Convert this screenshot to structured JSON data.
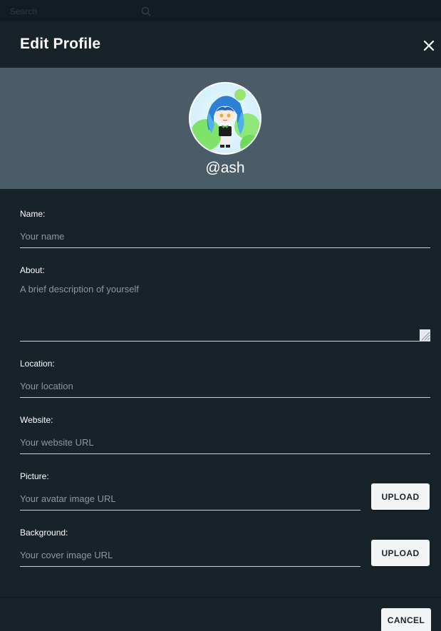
{
  "background": {
    "search_text": "Search",
    "search_icon": "search-icon"
  },
  "dialog": {
    "title": "Edit Profile",
    "close_icon": "close-icon"
  },
  "profile": {
    "username": "@ash",
    "avatar": "anime-character-avatar"
  },
  "form": {
    "name": {
      "label": "Name:",
      "placeholder": "Your name",
      "value": ""
    },
    "about": {
      "label": "About:",
      "placeholder": "A brief description of yourself",
      "value": ""
    },
    "location": {
      "label": "Location:",
      "placeholder": "Your location",
      "value": ""
    },
    "website": {
      "label": "Website:",
      "placeholder": "Your website URL",
      "value": ""
    },
    "picture": {
      "label": "Picture:",
      "placeholder": "Your avatar image URL",
      "value": "",
      "button": "UPLOAD"
    },
    "background": {
      "label": "Background:",
      "placeholder": "Your cover image URL",
      "value": "",
      "button": "UPLOAD"
    }
  },
  "footer": {
    "cancel_label": "CANCEL"
  },
  "colors": {
    "panel": "#172229",
    "banner": "#4a5c67",
    "button_bg": "#f3f4f5",
    "input_border": "#c9d1d6",
    "placeholder": "#8d979d"
  }
}
